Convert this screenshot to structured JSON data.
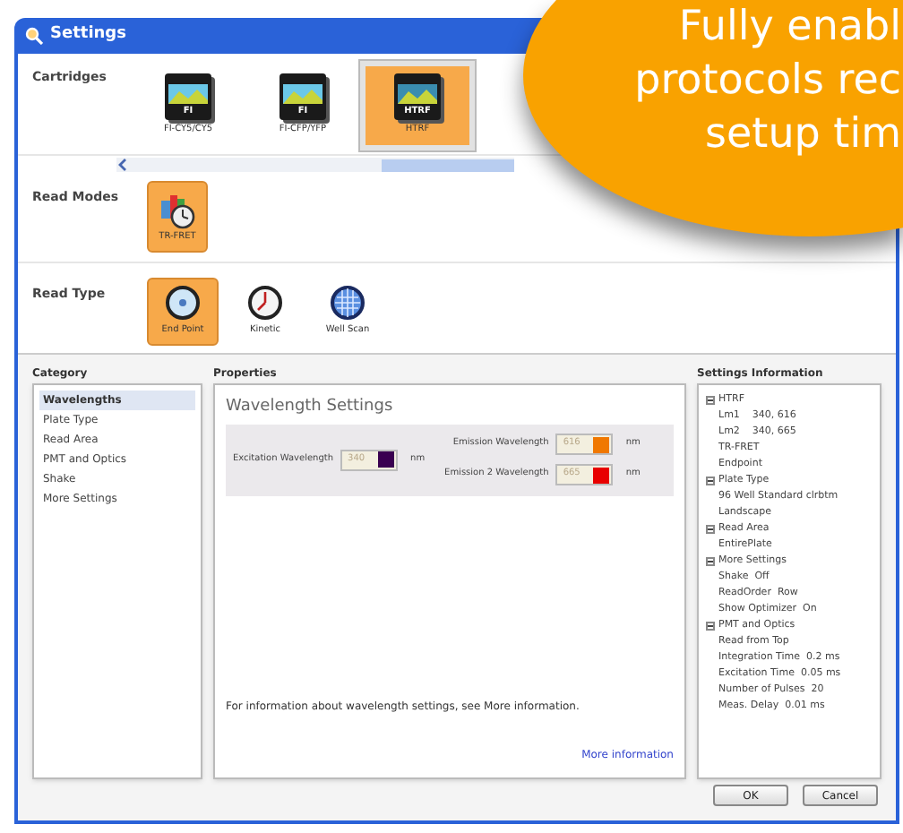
{
  "window": {
    "title": "Settings"
  },
  "cartridges": {
    "label": "Cartridges",
    "items": [
      {
        "badge": "FI",
        "label": "FI-CY5/CY5",
        "selected": false
      },
      {
        "badge": "FI",
        "label": "FI-CFP/YFP",
        "selected": false
      },
      {
        "badge": "HTRF",
        "label": "HTRF",
        "selected": true
      }
    ]
  },
  "read_modes": {
    "label": "Read Modes",
    "items": [
      {
        "label": "TR-FRET",
        "selected": true
      }
    ]
  },
  "read_type": {
    "label": "Read Type",
    "items": [
      {
        "kind": "endpoint",
        "label": "End Point",
        "selected": true
      },
      {
        "kind": "kinetic",
        "label": "Kinetic",
        "selected": false
      },
      {
        "kind": "wellscan",
        "label": "Well Scan",
        "selected": false
      }
    ]
  },
  "category": {
    "title": "Category",
    "items": [
      {
        "label": "Wavelengths",
        "selected": true
      },
      {
        "label": "Plate Type",
        "selected": false
      },
      {
        "label": "Read Area",
        "selected": false
      },
      {
        "label": "PMT and Optics",
        "selected": false
      },
      {
        "label": "Shake",
        "selected": false
      },
      {
        "label": "More Settings",
        "selected": false
      }
    ]
  },
  "properties": {
    "title": "Properties",
    "heading": "Wavelength Settings",
    "excitation": {
      "label": "Excitation Wavelength",
      "value": "340",
      "color": "#3a0050",
      "unit": "nm"
    },
    "emissions": [
      {
        "label": "Emission Wavelength",
        "value": "616",
        "color": "#f07800",
        "unit": "nm"
      },
      {
        "label": "Emission 2 Wavelength",
        "value": "665",
        "color": "#e80000",
        "unit": "nm"
      }
    ],
    "info": "For information about wavelength settings, see More information.",
    "link": "More information"
  },
  "settings_information": {
    "title": "Settings Information",
    "tree": [
      {
        "label": "HTRF",
        "expanded": true,
        "children": [
          {
            "label": "Lm1    340, 616"
          },
          {
            "label": "Lm2    340, 665"
          },
          {
            "label": "TR-FRET"
          },
          {
            "label": "Endpoint"
          }
        ]
      },
      {
        "label": "Plate Type",
        "expanded": true,
        "children": [
          {
            "label": "96 Well Standard clrbtm"
          },
          {
            "label": "Landscape"
          }
        ]
      },
      {
        "label": "Read Area",
        "expanded": true,
        "children": [
          {
            "label": "EntirePlate"
          }
        ]
      },
      {
        "label": "More Settings",
        "expanded": true,
        "children": [
          {
            "label": "Shake  Off"
          },
          {
            "label": "ReadOrder  Row"
          },
          {
            "label": "Show Optimizer  On"
          }
        ]
      },
      {
        "label": "PMT and Optics",
        "expanded": true,
        "children": [
          {
            "label": "Read from Top"
          },
          {
            "label": "Integration Time  0.2 ms"
          },
          {
            "label": "Excitation Time  0.05 ms"
          },
          {
            "label": "Number of Pulses  20"
          },
          {
            "label": "Meas. Delay  0.01 ms"
          }
        ]
      }
    ]
  },
  "buttons": [
    "OK",
    "Cancel"
  ],
  "callout": {
    "lines": [
      "Fully enabl",
      "protocols rec",
      "setup tim"
    ]
  }
}
